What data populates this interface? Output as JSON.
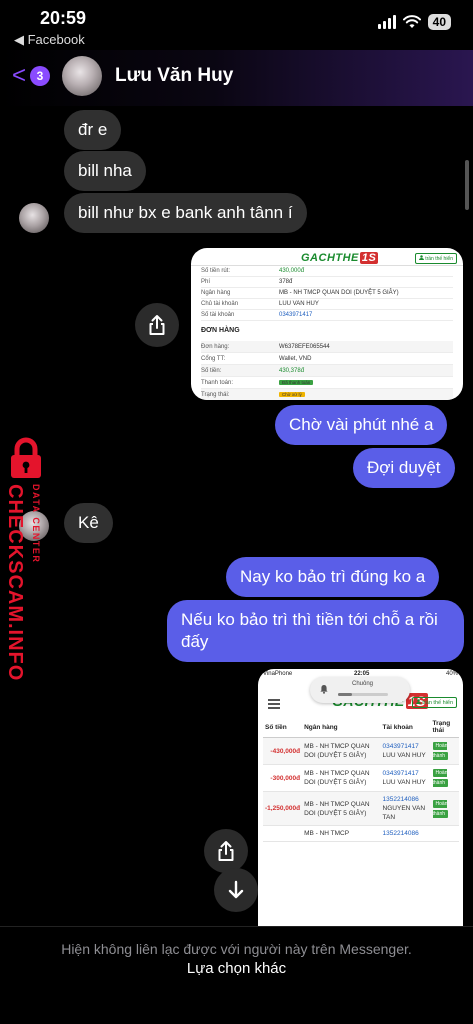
{
  "status_bar": {
    "time": "20:59",
    "back_app": "◀ Facebook",
    "battery": "40"
  },
  "header": {
    "unread_count": "3",
    "contact_name": "Lưu Văn Huy"
  },
  "messages": {
    "m1": "đr e",
    "m2": "bill nha",
    "m3": "bill như bx e bank anh tânn í",
    "m4": "Chờ vài phút nhé a",
    "m5": "Đợi duyệt",
    "m6": "Kê",
    "m7": "Nay ko bảo trì đúng ko a",
    "m8": "Nếu ko bảo trì thì tiền tới chỗ a rồi đấy"
  },
  "screenshot1": {
    "logo": "GACHTHE",
    "logo_num": "1S",
    "account_btn": "trần thế hiển",
    "rows": [
      {
        "label": "Số tiền rút:",
        "value": "430,000đ"
      },
      {
        "label": "Phí",
        "value": "378đ"
      },
      {
        "label": "Ngân hàng",
        "value": "MB - NH TMCP QUAN DOI (DUYỆT 5 GIÂY)"
      },
      {
        "label": "Chủ tài khoản",
        "value": "LUU VAN HUY"
      },
      {
        "label": "Số tài khoản",
        "value": "0343971417"
      }
    ],
    "order_title": "ĐƠN HÀNG",
    "order_rows": [
      {
        "label": "Đơn hàng:",
        "value": "W6378EFE065544"
      },
      {
        "label": "Cổng TT:",
        "value": "Wallet, VND"
      },
      {
        "label": "Số tiền:",
        "value": "430,378đ"
      },
      {
        "label": "Thanh toán:",
        "value": "Đã thanh toán"
      },
      {
        "label": "Trạng thái:",
        "value": "Chờ xử lý"
      }
    ]
  },
  "screenshot2": {
    "carrier": "VinaPhone",
    "time": "22:05",
    "battery": "40%",
    "notification": "Chuông",
    "logo": "GACHTHE",
    "logo_num": "1S",
    "account_btn": "trần thế hiển",
    "headers": [
      "Số tiền",
      "Ngân hàng",
      "Tài khoản",
      "Trạng thái"
    ],
    "rows": [
      {
        "amount": "-430,000đ",
        "bank": "MB - NH TMCP QUAN DOI (DUYỆT 5 GIÂY)",
        "account": "0343971417",
        "holder": "LUU VAN HUY",
        "status": "Hoàn thành"
      },
      {
        "amount": "-300,000đ",
        "bank": "MB - NH TMCP QUAN DOI (DUYỆT 5 GIÂY)",
        "account": "0343971417",
        "holder": "LUU VAN HUY",
        "status": "Hoàn thành"
      },
      {
        "amount": "-1,250,000đ",
        "bank": "MB - NH TMCP QUAN DOI (DUYỆT 5 GIÂY)",
        "account": "1352214086",
        "holder": "NGUYEN VAN TAN",
        "status": "Hoàn thành"
      },
      {
        "amount": "",
        "bank": "MB - NH TMCP",
        "account": "1352214086",
        "holder": "",
        "status": ""
      }
    ]
  },
  "footer": {
    "note": "Hiện không liên lạc được với người này trên Messenger.",
    "link": "Lựa chọn khác"
  },
  "watermark": {
    "site": "CHECKSCAM.INFO",
    "sub": "DATA CENTER"
  },
  "colors": {
    "accent": "#8a4bff",
    "outgoing_bubble": "#5a5ee8",
    "incoming_bubble": "#303030",
    "watermark": "#e4142c"
  },
  "icons": [
    "signal-icon",
    "wifi-icon",
    "back-chevron-icon",
    "share-icon",
    "arrow-down-icon",
    "bell-icon",
    "lock-icon",
    "user-icon",
    "menu-icon"
  ]
}
